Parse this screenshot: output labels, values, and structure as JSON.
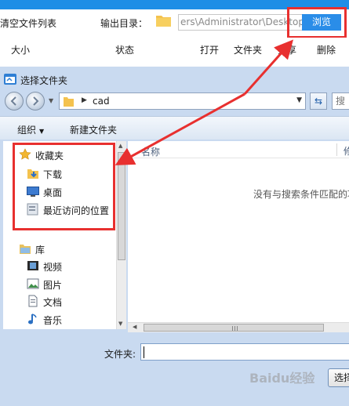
{
  "app": {
    "clear_list_label": "清空文件列表",
    "output_dir_label": "输出目录：",
    "output_path_value": "ers\\Administrator\\Desktop",
    "browse_label": "浏览",
    "columns": [
      "大小",
      "状态",
      "打开",
      "文件夹",
      "分享",
      "删除"
    ]
  },
  "dialog": {
    "title": "选择文件夹",
    "address": "cad",
    "search_placeholder": "搜",
    "toolbar": {
      "organize_label": "组织",
      "new_folder_label": "新建文件夹"
    },
    "nav_tree": {
      "favorites": {
        "label": "收藏夹",
        "items": [
          "下载",
          "桌面",
          "最近访问的位置"
        ]
      },
      "libraries": {
        "label": "库",
        "items": [
          "视频",
          "图片",
          "文档",
          "音乐"
        ]
      }
    },
    "list": {
      "name_column": "名称",
      "extra_column": "修",
      "empty_message": "没有与搜索条件匹配的项。"
    },
    "filename_label": "文件夹:",
    "filename_value": "",
    "select_button_label": "选择"
  },
  "watermark_text": "Baidu经验",
  "colors": {
    "highlight_red": "#e8302f",
    "browse_blue": "#2a8de8",
    "dialog_bg": "#c9daf0",
    "folder_yellow": "#f4c24e"
  },
  "icons": {
    "favorites": "star-icon",
    "downloads": "download-folder-icon",
    "desktop": "desktop-icon",
    "recent": "recent-places-icon",
    "libraries": "library-icon",
    "videos": "video-icon",
    "pictures": "picture-icon",
    "documents": "document-icon",
    "music": "music-note-icon"
  }
}
